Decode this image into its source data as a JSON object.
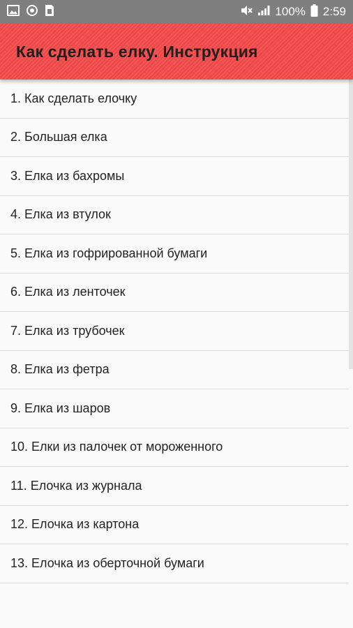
{
  "status_bar": {
    "battery_percent": "100%",
    "time": "2:59",
    "left_icons": [
      "image-icon",
      "sync-icon",
      "sim-card-icon"
    ],
    "right_icons": [
      "mute-icon",
      "signal-icon",
      "battery-icon"
    ]
  },
  "app_bar": {
    "title": "Как сделать елку. Инструкция",
    "color": "#f44b4b"
  },
  "list": {
    "items": [
      "1. Как сделать елочку",
      "2. Большая елка",
      "3. Елка из бахромы",
      "4. Елка из втулок",
      "5. Елка из гофрированной бумаги",
      "6. Елка из ленточек",
      "7. Елка из трубочек",
      "8. Елка из фетра",
      "9. Елка из шаров",
      "10. Елки из палочек от мороженного",
      "11. Елочка из журнала",
      "12. Елочка из картона",
      "13. Елочка из оберточной бумаги"
    ]
  }
}
